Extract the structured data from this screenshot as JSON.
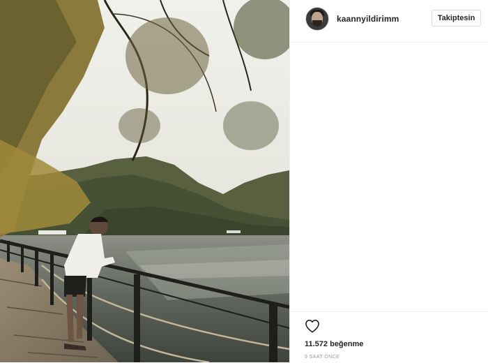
{
  "post": {
    "username": "kaannyildirimm",
    "follow_label": "Takiptesin",
    "likes": "11.572 beğenme",
    "timestamp": "9 SAAT ÖNCE"
  },
  "icons": {
    "like": "heart-outline-icon"
  },
  "colors": {
    "text": "#262626",
    "border": "#dbdbdb",
    "timestamp": "#999999"
  }
}
